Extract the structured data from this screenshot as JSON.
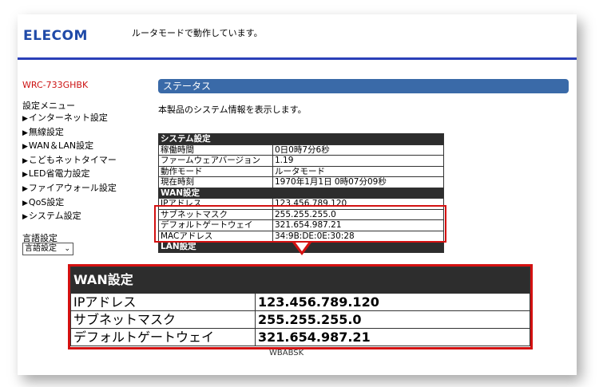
{
  "header": {
    "logo": "ELECOM",
    "status_message": "ルータモードで動作しています。"
  },
  "sidebar": {
    "model": "WRC-733GHBK",
    "menu_title": "設定メニュー",
    "items": [
      {
        "label": "インターネット設定"
      },
      {
        "label": "無線設定"
      },
      {
        "label": "WAN＆LAN設定"
      },
      {
        "label": "こどもネットタイマー"
      },
      {
        "label": "LED省電力設定"
      },
      {
        "label": "ファイアウォール設定"
      },
      {
        "label": "QoS設定"
      },
      {
        "label": "システム設定"
      }
    ],
    "language_label": "言語設定",
    "language_select": "言語設定"
  },
  "main": {
    "section_title": "ステータス",
    "description": "本製品のシステム情報を表示します。",
    "system": {
      "header": "システム設定",
      "rows": [
        {
          "key": "稼働時間",
          "value": "0日0時7分6秒"
        },
        {
          "key": "ファームウェアバージョン",
          "value": "1.19"
        },
        {
          "key": "動作モード",
          "value": "ルータモード"
        },
        {
          "key": "現在時刻",
          "value": "1970年1月1日 0時07分09秒"
        }
      ]
    },
    "wan": {
      "header": "WAN設定",
      "rows": [
        {
          "key": "IPアドレス",
          "value": "123.456.789.120"
        },
        {
          "key": "サブネットマスク",
          "value": "255.255.255.0"
        },
        {
          "key": "デフォルトゲートウェイ",
          "value": "321.654.987.21"
        },
        {
          "key": "MACアドレス",
          "value": "34:9B:DE:0E:30:28"
        }
      ]
    },
    "lan_header": "LAN設定",
    "partial_below_value": "WBABSK"
  },
  "zoom": {
    "header": "WAN設定",
    "rows": [
      {
        "key": "IPアドレス",
        "value": "123.456.789.120"
      },
      {
        "key": "サブネットマスク",
        "value": "255.255.255.0"
      },
      {
        "key": "デフォルトゲートウェイ",
        "value": "321.654.987.21"
      }
    ]
  },
  "colors": {
    "accent_blue": "#2a3fb8",
    "section_bar": "#3a6aa8",
    "highlight_red": "#d41111",
    "model_red": "#cc1111",
    "table_header": "#2d2d2d"
  }
}
